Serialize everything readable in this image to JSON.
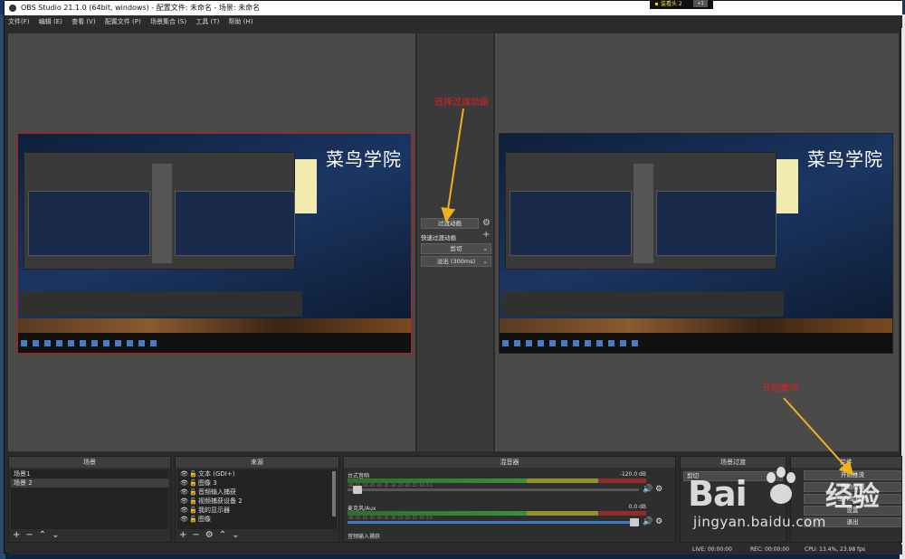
{
  "window": {
    "title": "OBS Studio 21.1.0 (64bit, windows) - 配置文件: 未命名 - 场景: 未命名",
    "popup_label": "监看头 2",
    "popup_badge": "+1"
  },
  "menubar": [
    "文件(F)",
    "编辑 (E)",
    "查看 (V)",
    "配置文件 (P)",
    "场景集合 (S)",
    "工具 (T)",
    "帮助 (H)"
  ],
  "preview": {
    "brand_text": "菜鸟学院"
  },
  "transition_panel": {
    "transition_button": "过渡动画",
    "quick_label": "快速过渡动画",
    "cut_option": "剪切",
    "fade_option": "淡出 (300ms)"
  },
  "annotations": {
    "select_transition": "选择过渡动画",
    "start_stream": "开始推流"
  },
  "docks": {
    "scenes": {
      "header": "场景",
      "items": [
        "场景1",
        "场景 2"
      ],
      "selected_index": 1
    },
    "sources": {
      "header": "来源",
      "items": [
        "文本 (GDI+)",
        "图像 3",
        "音频输入捕获",
        "视频捕获设备 2",
        "我的显示器",
        "图像"
      ]
    },
    "mixer": {
      "header": "混音器",
      "channels": [
        {
          "name": "台式音响",
          "db": "-120.0 dB",
          "volume": 0.02
        },
        {
          "name": "麦克风/Aux",
          "db": "0.0 dB",
          "volume": 1.0
        },
        {
          "name": "音频输入捕获",
          "db": "",
          "volume": 1.0
        }
      ],
      "scale_ticks": [
        "-60",
        "-55",
        "-50",
        "-45",
        "-40",
        "-35",
        "-30",
        "-25",
        "-20",
        "-15",
        "-10",
        "-5",
        "0"
      ]
    },
    "transitions": {
      "header": "场景过渡",
      "value": "剪切"
    },
    "controls": {
      "header": "控件",
      "start_streaming": "开始推流",
      "start_recording": "开始录制",
      "studio_mode": "工作室模式",
      "settings": "设置",
      "exit": "退出"
    }
  },
  "status": {
    "live": "LIVE: 00:00:00",
    "rec": "REC: 00:00:00",
    "cpu": "CPU: 13.4%, 23.98 fps"
  },
  "watermark": {
    "logo_left": "Bai",
    "logo_right": "经验",
    "url": "jingyan.baidu.com"
  }
}
